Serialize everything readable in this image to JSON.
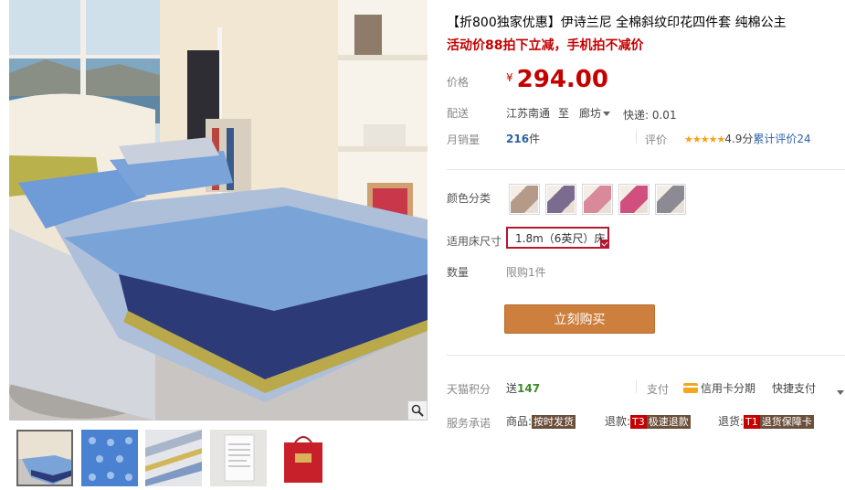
{
  "product": {
    "title": "【折800独家优惠】伊诗兰尼 全棉斜纹印花四件套 纯棉公主",
    "promo": "活动价88拍下立减，手机拍不减价"
  },
  "price": {
    "label": "价格",
    "currency": "¥",
    "value": "294.00"
  },
  "shipping": {
    "label": "配送",
    "from": "江苏南通",
    "to_word": "至",
    "to": "廊坊",
    "express": "快递: 0.01"
  },
  "sales": {
    "label": "月销量",
    "count": "216",
    "unit": "件"
  },
  "rating": {
    "label": "评价",
    "stars": "★★★★★",
    "score": "4.9分",
    "reviews_text": "累计评价",
    "reviews_count": "24"
  },
  "color": {
    "label": "颜色分类",
    "swatches": [
      {
        "name": "swatch-1",
        "color": "#b59a8a"
      },
      {
        "name": "swatch-2",
        "color": "#7b6b8f"
      },
      {
        "name": "swatch-3",
        "color": "#d98a9a"
      },
      {
        "name": "swatch-4",
        "color": "#d04f7f"
      },
      {
        "name": "swatch-5",
        "color": "#8c8a92"
      }
    ]
  },
  "size": {
    "label": "适用床尺寸",
    "selected": "1.8m（6英尺）床"
  },
  "quantity": {
    "label": "数量",
    "limit": "限购1件"
  },
  "buy_button": "立刻购买",
  "tmall_points": {
    "label": "天猫积分",
    "prefix": "送",
    "value": "147"
  },
  "payment": {
    "label": "支付",
    "credit": "信用卡分期",
    "quick": "快捷支付"
  },
  "service": {
    "label": "服务承诺",
    "goods_label": "商品:",
    "goods_tag": "按时发货",
    "refund_label": "退款:",
    "refund_code": "T3",
    "refund_tag": "极速退款",
    "return_label": "退货:",
    "return_code": "T1",
    "return_tag": "退货保障卡"
  },
  "colors": {
    "price_red": "#c40000",
    "buy_button": "#cd7f3d",
    "selected_border": "#b4172f",
    "points_green": "#3c8b2a"
  }
}
